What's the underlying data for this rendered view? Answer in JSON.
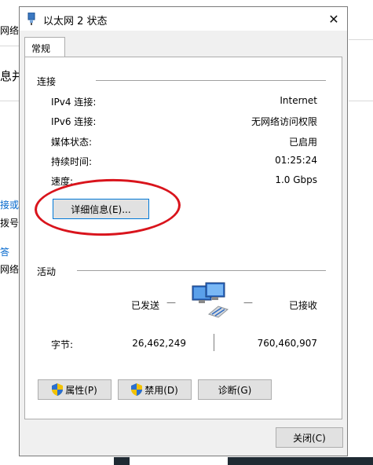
{
  "background": {
    "fragments": [
      "网络和",
      "息并",
      "接或",
      "拨号",
      "答",
      "网络"
    ]
  },
  "dialog": {
    "title": "以太网 2 状态",
    "close_glyph": "✕",
    "tab_label": "常规",
    "connection": {
      "section_title": "连接",
      "rows": [
        {
          "label": "IPv4 连接:",
          "value": "Internet"
        },
        {
          "label": "IPv6 连接:",
          "value": "无网络访问权限"
        },
        {
          "label": "媒体状态:",
          "value": "已启用"
        },
        {
          "label": "持续时间:",
          "value": "01:25:24"
        },
        {
          "label": "速度:",
          "value": "1.0 Gbps"
        }
      ],
      "details_button": "详细信息(E)..."
    },
    "activity": {
      "section_title": "活动",
      "sent_label": "已发送",
      "dash": "—",
      "received_label": "已接收",
      "bytes_label": "字节:",
      "sent_bytes": "26,462,249",
      "received_bytes": "760,460,907"
    },
    "buttons": {
      "properties": "属性(P)",
      "disable": "禁用(D)",
      "diagnose": "诊断(G)",
      "close": "关闭(C)"
    }
  },
  "colors": {
    "annotation_circle": "#d9141c",
    "dialog_bg": "#f0f0f0",
    "focus_border": "#0078d7"
  }
}
